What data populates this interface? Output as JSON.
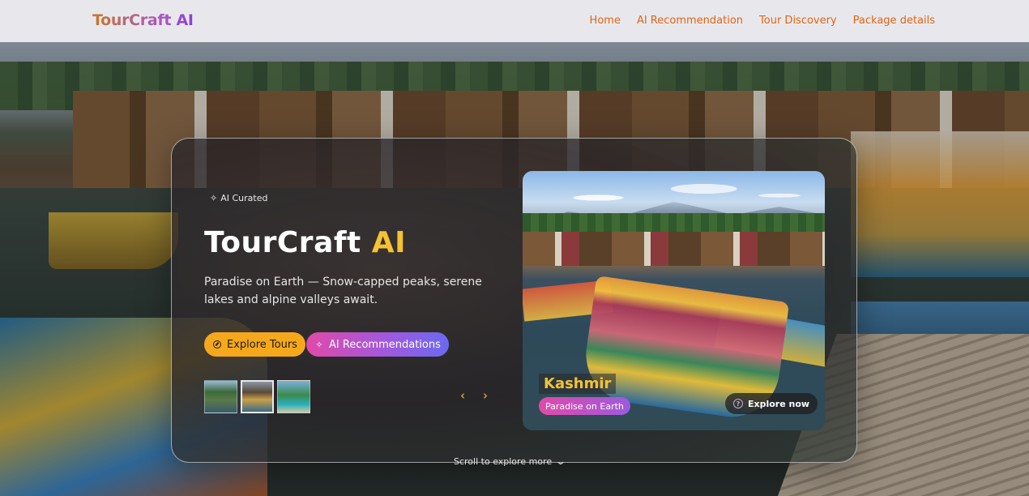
{
  "nav": {
    "brand": "TourCraft AI",
    "links": [
      "Home",
      "AI Recommendation",
      "Tour Discovery",
      "Package details"
    ]
  },
  "hero": {
    "badge": "AI Curated",
    "title_main": "TourCraft ",
    "title_accent": "AI",
    "description": "Paradise on Earth — Snow-capped peaks, serene lakes and alpine valleys await.",
    "btn_explore": "Explore Tours",
    "btn_ai": "AI Recommendations",
    "thumbnails_active_index": 1,
    "arrow_prev": "‹",
    "arrow_next": "›"
  },
  "feature": {
    "place": "Kashmir",
    "tagline": "Paradise on Earth",
    "cta": "Explore now"
  },
  "scroll_hint": "Scroll to explore more",
  "colors": {
    "accent_yellow": "#f6c232",
    "accent_orange": "#f6a81c",
    "nav_link": "#e36414",
    "gradient_pink": "#e04aa8",
    "gradient_purple": "#9c5ae0"
  },
  "icons": [
    "sparkle-icon",
    "compass-icon",
    "sparkle-icon",
    "chevron-left-icon",
    "chevron-right-icon",
    "question-circle-icon",
    "chevron-down-icon"
  ]
}
